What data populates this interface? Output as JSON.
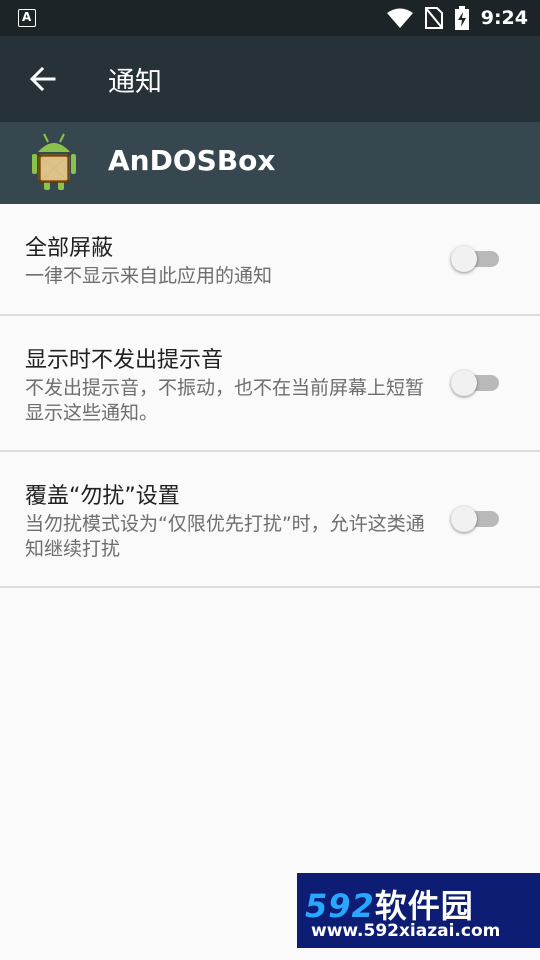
{
  "status_bar": {
    "notification_icon": "a-box-icon",
    "time": "9:24",
    "icons": [
      "wifi-icon",
      "no-sim-icon",
      "battery-charging-icon"
    ]
  },
  "toolbar": {
    "back_icon": "arrow-back-icon",
    "title": "通知"
  },
  "app_header": {
    "app_name": "AnDOSBox",
    "app_icon": "android-dosbox-icon"
  },
  "settings": [
    {
      "title": "全部屏蔽",
      "summary": "一律不显示来自此应用的通知",
      "enabled": false
    },
    {
      "title": "显示时不发出提示音",
      "summary": "不发出提示音，不振动，也不在当前屏幕上短暂显示这些通知。",
      "enabled": false
    },
    {
      "title": "覆盖“勿扰”设置",
      "summary": "当勿扰模式设为“仅限优先打扰”时，允许这类通知继续打扰",
      "enabled": false
    }
  ],
  "watermark": {
    "brand_num": "592",
    "brand_text": "软件园",
    "url": "www.592xiazai.com"
  },
  "colors": {
    "status_bar": "#1d2428",
    "toolbar": "#263238",
    "app_header": "#37474f",
    "background": "#fafafa",
    "switch_off_track": "#b9b9b9",
    "watermark": "#0d1d73"
  }
}
